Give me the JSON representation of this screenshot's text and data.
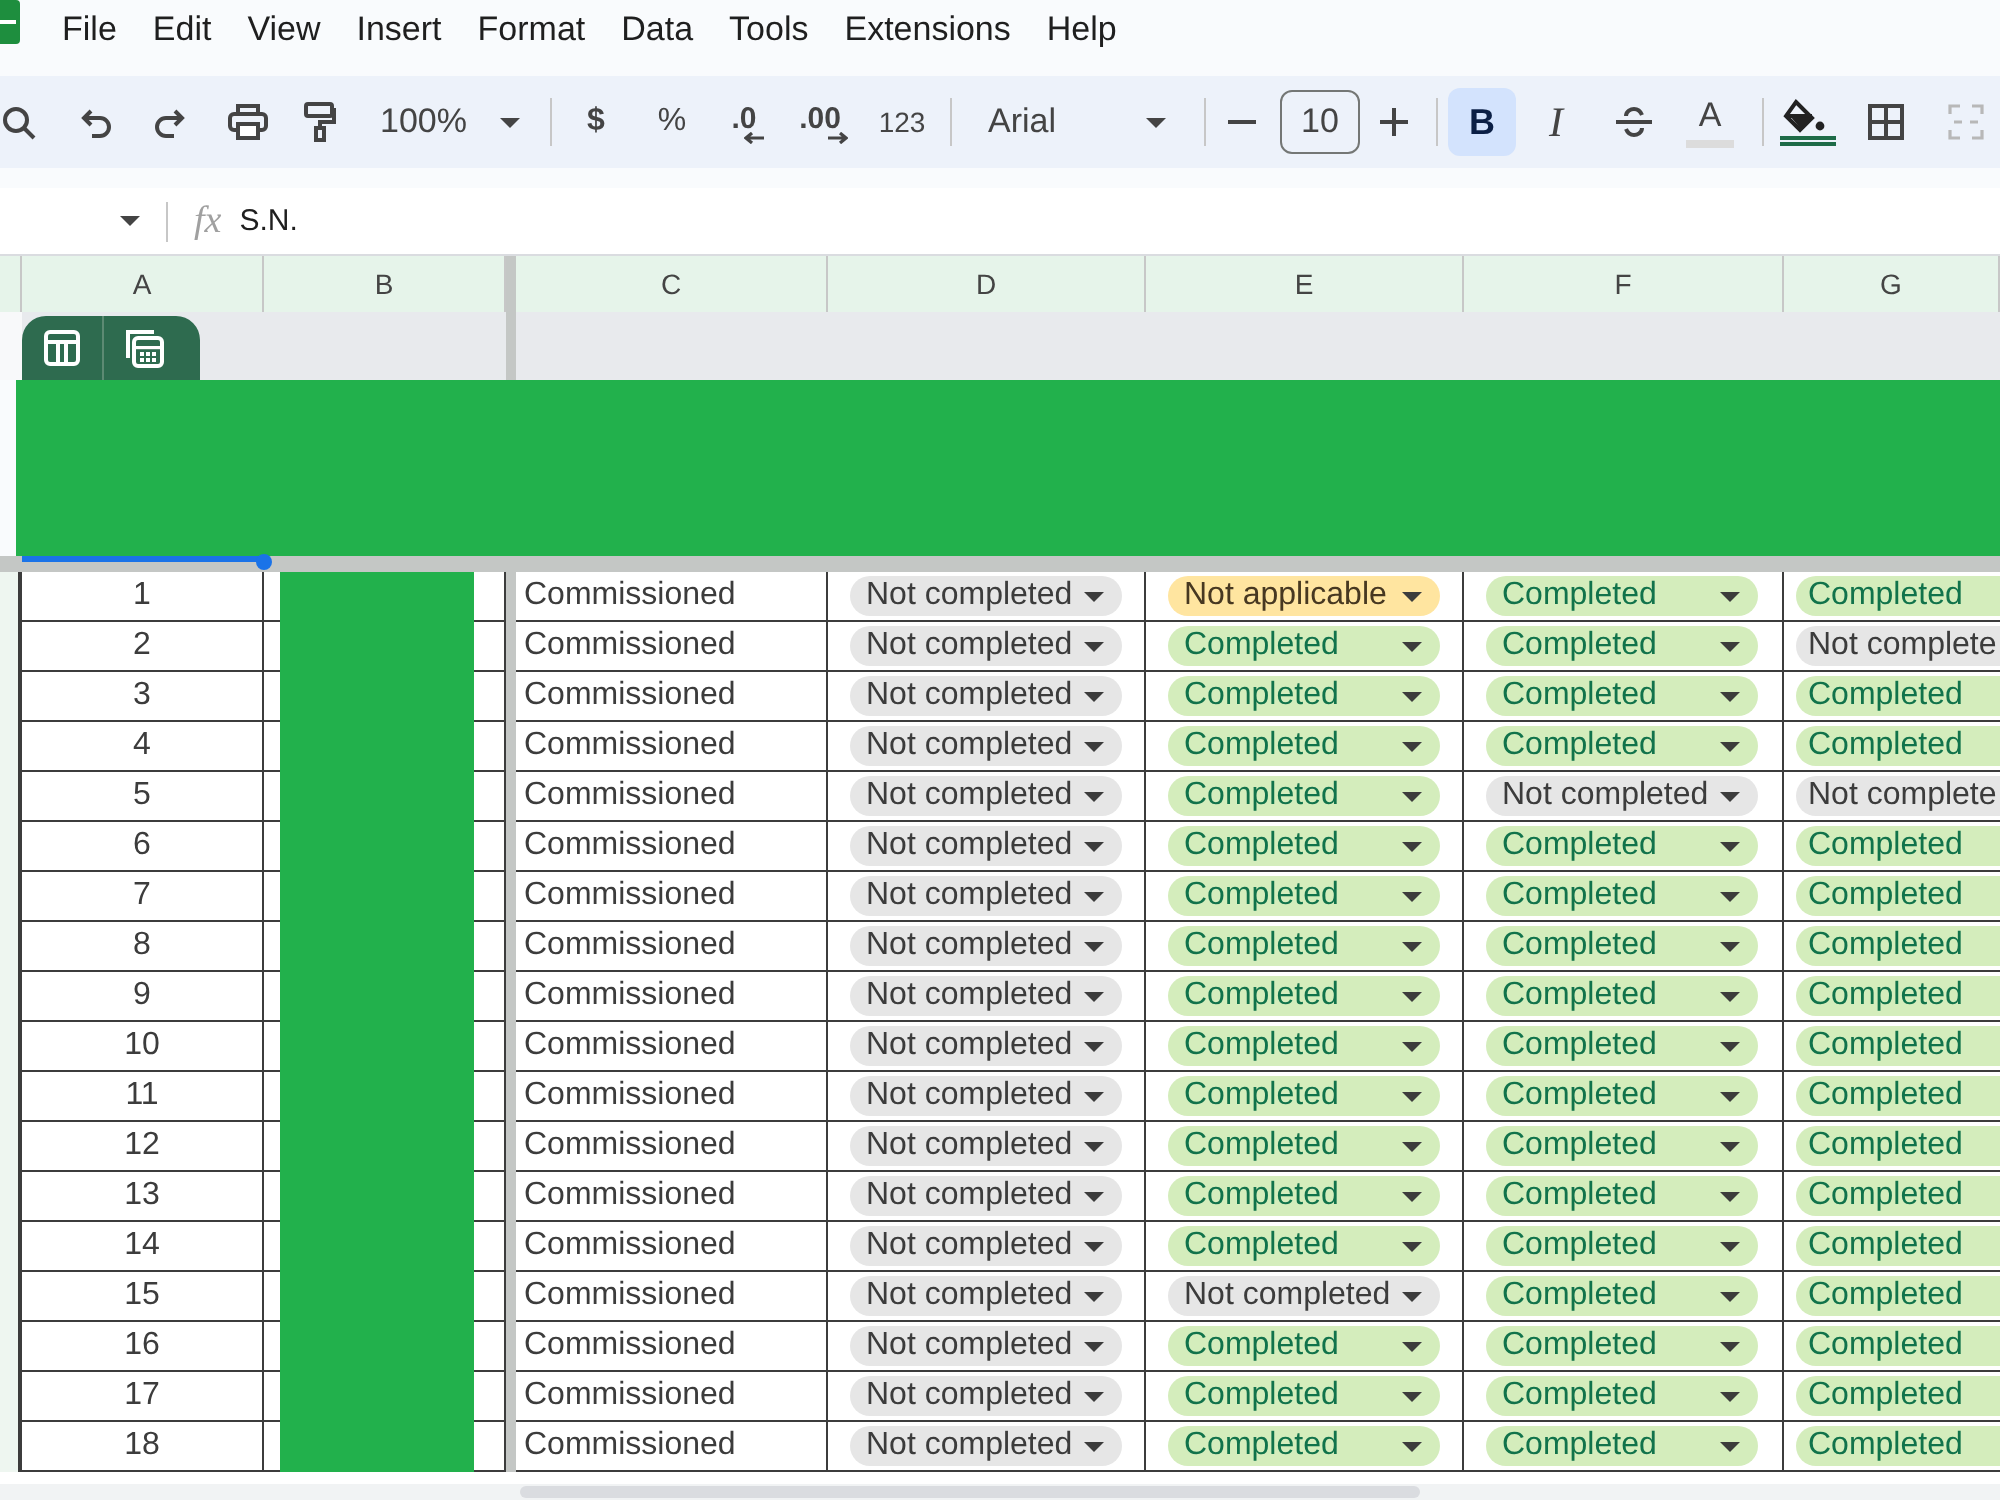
{
  "menu_bar": {
    "items": [
      "File",
      "Edit",
      "View",
      "Insert",
      "Format",
      "Data",
      "Tools",
      "Extensions",
      "Help"
    ]
  },
  "toolbar": {
    "zoom": "100%",
    "currency": "$",
    "percent": "%",
    "decrease_decimal": ".0",
    "increase_decimal": ".00",
    "number_format": "123",
    "font": "Arial",
    "font_size": "10",
    "formatting": [
      {
        "kind": "bold",
        "label": "B",
        "on": true
      },
      {
        "kind": "italic",
        "label": "I",
        "on": false
      }
    ],
    "text_color": "A"
  },
  "formula_bar": {
    "function_label": "fx",
    "value": "S.N."
  },
  "sheet": {
    "columns": [
      "A",
      "B",
      "C",
      "D",
      "E",
      "F",
      "G"
    ],
    "rows": [
      {
        "cells": [
          {
            "kind": "number",
            "text": "1"
          },
          {
            "kind": "redacted"
          },
          {
            "kind": "text",
            "text": "Commissioned"
          },
          {
            "kind": "status",
            "text": "Not completed",
            "color": "#e6e6e6"
          },
          {
            "kind": "status",
            "text": "Not applicable",
            "color": "#ffe5a0"
          },
          {
            "kind": "status",
            "text": "Completed",
            "color": "#d4edbc"
          },
          {
            "kind": "status",
            "text": "Completed",
            "color": "#d4edbc"
          }
        ]
      },
      {
        "cells": [
          {
            "kind": "number",
            "text": "2"
          },
          {
            "kind": "redacted"
          },
          {
            "kind": "text",
            "text": "Commissioned"
          },
          {
            "kind": "status",
            "text": "Not completed",
            "color": "#e6e6e6"
          },
          {
            "kind": "status",
            "text": "Completed",
            "color": "#d4edbc"
          },
          {
            "kind": "status",
            "text": "Completed",
            "color": "#d4edbc"
          },
          {
            "kind": "status",
            "text": "Not complete",
            "color": "#e6e6e6"
          }
        ]
      },
      {
        "cells": [
          {
            "kind": "number",
            "text": "3"
          },
          {
            "kind": "redacted"
          },
          {
            "kind": "text",
            "text": "Commissioned"
          },
          {
            "kind": "status",
            "text": "Not completed",
            "color": "#e6e6e6"
          },
          {
            "kind": "status",
            "text": "Completed",
            "color": "#d4edbc"
          },
          {
            "kind": "status",
            "text": "Completed",
            "color": "#d4edbc"
          },
          {
            "kind": "status",
            "text": "Completed",
            "color": "#d4edbc"
          }
        ]
      },
      {
        "cells": [
          {
            "kind": "number",
            "text": "4"
          },
          {
            "kind": "redacted"
          },
          {
            "kind": "text",
            "text": "Commissioned"
          },
          {
            "kind": "status",
            "text": "Not completed",
            "color": "#e6e6e6"
          },
          {
            "kind": "status",
            "text": "Completed",
            "color": "#d4edbc"
          },
          {
            "kind": "status",
            "text": "Completed",
            "color": "#d4edbc"
          },
          {
            "kind": "status",
            "text": "Completed",
            "color": "#d4edbc"
          }
        ]
      },
      {
        "cells": [
          {
            "kind": "number",
            "text": "5"
          },
          {
            "kind": "redacted"
          },
          {
            "kind": "text",
            "text": "Commissioned"
          },
          {
            "kind": "status",
            "text": "Not completed",
            "color": "#e6e6e6"
          },
          {
            "kind": "status",
            "text": "Completed",
            "color": "#d4edbc"
          },
          {
            "kind": "status",
            "text": "Not completed",
            "color": "#e6e6e6"
          },
          {
            "kind": "status",
            "text": "Not complete",
            "color": "#e6e6e6"
          }
        ]
      },
      {
        "cells": [
          {
            "kind": "number",
            "text": "6"
          },
          {
            "kind": "redacted"
          },
          {
            "kind": "text",
            "text": "Commissioned"
          },
          {
            "kind": "status",
            "text": "Not completed",
            "color": "#e6e6e6"
          },
          {
            "kind": "status",
            "text": "Completed",
            "color": "#d4edbc"
          },
          {
            "kind": "status",
            "text": "Completed",
            "color": "#d4edbc"
          },
          {
            "kind": "status",
            "text": "Completed",
            "color": "#d4edbc"
          }
        ]
      },
      {
        "cells": [
          {
            "kind": "number",
            "text": "7"
          },
          {
            "kind": "redacted"
          },
          {
            "kind": "text",
            "text": "Commissioned"
          },
          {
            "kind": "status",
            "text": "Not completed",
            "color": "#e6e6e6"
          },
          {
            "kind": "status",
            "text": "Completed",
            "color": "#d4edbc"
          },
          {
            "kind": "status",
            "text": "Completed",
            "color": "#d4edbc"
          },
          {
            "kind": "status",
            "text": "Completed",
            "color": "#d4edbc"
          }
        ]
      },
      {
        "cells": [
          {
            "kind": "number",
            "text": "8"
          },
          {
            "kind": "redacted"
          },
          {
            "kind": "text",
            "text": "Commissioned"
          },
          {
            "kind": "status",
            "text": "Not completed",
            "color": "#e6e6e6"
          },
          {
            "kind": "status",
            "text": "Completed",
            "color": "#d4edbc"
          },
          {
            "kind": "status",
            "text": "Completed",
            "color": "#d4edbc"
          },
          {
            "kind": "status",
            "text": "Completed",
            "color": "#d4edbc"
          }
        ]
      },
      {
        "cells": [
          {
            "kind": "number",
            "text": "9"
          },
          {
            "kind": "redacted"
          },
          {
            "kind": "text",
            "text": "Commissioned"
          },
          {
            "kind": "status",
            "text": "Not completed",
            "color": "#e6e6e6"
          },
          {
            "kind": "status",
            "text": "Completed",
            "color": "#d4edbc"
          },
          {
            "kind": "status",
            "text": "Completed",
            "color": "#d4edbc"
          },
          {
            "kind": "status",
            "text": "Completed",
            "color": "#d4edbc"
          }
        ]
      },
      {
        "cells": [
          {
            "kind": "number",
            "text": "10"
          },
          {
            "kind": "redacted"
          },
          {
            "kind": "text",
            "text": "Commissioned"
          },
          {
            "kind": "status",
            "text": "Not completed",
            "color": "#e6e6e6"
          },
          {
            "kind": "status",
            "text": "Completed",
            "color": "#d4edbc"
          },
          {
            "kind": "status",
            "text": "Completed",
            "color": "#d4edbc"
          },
          {
            "kind": "status",
            "text": "Completed",
            "color": "#d4edbc"
          }
        ]
      },
      {
        "cells": [
          {
            "kind": "number",
            "text": "11"
          },
          {
            "kind": "redacted"
          },
          {
            "kind": "text",
            "text": "Commissioned"
          },
          {
            "kind": "status",
            "text": "Not completed",
            "color": "#e6e6e6"
          },
          {
            "kind": "status",
            "text": "Completed",
            "color": "#d4edbc"
          },
          {
            "kind": "status",
            "text": "Completed",
            "color": "#d4edbc"
          },
          {
            "kind": "status",
            "text": "Completed",
            "color": "#d4edbc"
          }
        ]
      },
      {
        "cells": [
          {
            "kind": "number",
            "text": "12"
          },
          {
            "kind": "redacted"
          },
          {
            "kind": "text",
            "text": "Commissioned"
          },
          {
            "kind": "status",
            "text": "Not completed",
            "color": "#e6e6e6"
          },
          {
            "kind": "status",
            "text": "Completed",
            "color": "#d4edbc"
          },
          {
            "kind": "status",
            "text": "Completed",
            "color": "#d4edbc"
          },
          {
            "kind": "status",
            "text": "Completed",
            "color": "#d4edbc"
          }
        ]
      },
      {
        "cells": [
          {
            "kind": "number",
            "text": "13"
          },
          {
            "kind": "redacted"
          },
          {
            "kind": "text",
            "text": "Commissioned"
          },
          {
            "kind": "status",
            "text": "Not completed",
            "color": "#e6e6e6"
          },
          {
            "kind": "status",
            "text": "Completed",
            "color": "#d4edbc"
          },
          {
            "kind": "status",
            "text": "Completed",
            "color": "#d4edbc"
          },
          {
            "kind": "status",
            "text": "Completed",
            "color": "#d4edbc"
          }
        ]
      },
      {
        "cells": [
          {
            "kind": "number",
            "text": "14"
          },
          {
            "kind": "redacted"
          },
          {
            "kind": "text",
            "text": "Commissioned"
          },
          {
            "kind": "status",
            "text": "Not completed",
            "color": "#e6e6e6"
          },
          {
            "kind": "status",
            "text": "Completed",
            "color": "#d4edbc"
          },
          {
            "kind": "status",
            "text": "Completed",
            "color": "#d4edbc"
          },
          {
            "kind": "status",
            "text": "Completed",
            "color": "#d4edbc"
          }
        ]
      },
      {
        "cells": [
          {
            "kind": "number",
            "text": "15"
          },
          {
            "kind": "redacted"
          },
          {
            "kind": "text",
            "text": "Commissioned"
          },
          {
            "kind": "status",
            "text": "Not completed",
            "color": "#e6e6e6"
          },
          {
            "kind": "status",
            "text": "Not completed",
            "color": "#e6e6e6"
          },
          {
            "kind": "status",
            "text": "Completed",
            "color": "#d4edbc"
          },
          {
            "kind": "status",
            "text": "Completed",
            "color": "#d4edbc"
          }
        ]
      },
      {
        "cells": [
          {
            "kind": "number",
            "text": "16"
          },
          {
            "kind": "redacted"
          },
          {
            "kind": "text",
            "text": "Commissioned"
          },
          {
            "kind": "status",
            "text": "Not completed",
            "color": "#e6e6e6"
          },
          {
            "kind": "status",
            "text": "Completed",
            "color": "#d4edbc"
          },
          {
            "kind": "status",
            "text": "Completed",
            "color": "#d4edbc"
          },
          {
            "kind": "status",
            "text": "Completed",
            "color": "#d4edbc"
          }
        ]
      },
      {
        "cells": [
          {
            "kind": "number",
            "text": "17"
          },
          {
            "kind": "redacted"
          },
          {
            "kind": "text",
            "text": "Commissioned"
          },
          {
            "kind": "status",
            "text": "Not completed",
            "color": "#e6e6e6"
          },
          {
            "kind": "status",
            "text": "Completed",
            "color": "#d4edbc"
          },
          {
            "kind": "status",
            "text": "Completed",
            "color": "#d4edbc"
          },
          {
            "kind": "status",
            "text": "Completed",
            "color": "#d4edbc"
          }
        ]
      },
      {
        "cells": [
          {
            "kind": "number",
            "text": "18"
          },
          {
            "kind": "redacted"
          },
          {
            "kind": "text",
            "text": "Commissioned"
          },
          {
            "kind": "status",
            "text": "Not completed",
            "color": "#e6e6e6"
          },
          {
            "kind": "status",
            "text": "Completed",
            "color": "#d4edbc"
          },
          {
            "kind": "status",
            "text": "Completed",
            "color": "#d4edbc"
          },
          {
            "kind": "status",
            "text": "Completed",
            "color": "#d4edbc"
          }
        ]
      }
    ]
  }
}
